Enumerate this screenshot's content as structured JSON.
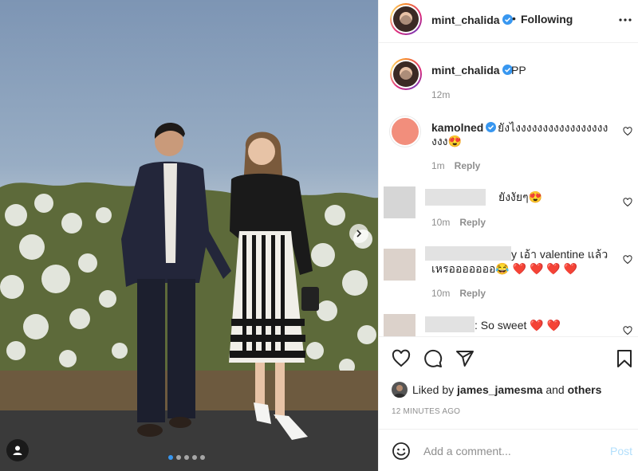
{
  "post": {
    "author": "mint_chalida",
    "follow_status": "Following",
    "separator": "•",
    "carousel_dots": 5,
    "active_dot": 0
  },
  "caption": {
    "author": "mint_chalida",
    "text": "PP",
    "time": "12m"
  },
  "comments": [
    {
      "author": "kamolned",
      "verified": true,
      "text_line1": "ยังไงงงงงงงงงงงงงงงงง",
      "text_line2": "งงง😍",
      "time": "1m",
      "reply": "Reply"
    },
    {
      "author_hidden": true,
      "text": "ยังงัยๆ😍",
      "time": "10m",
      "reply": "Reply"
    },
    {
      "author_hidden": true,
      "text_line1": "y เอ้า valentine แล้ว",
      "text_line2": "เหรอออออออ😂",
      "hearts": "❤️ ❤️ ❤️ ❤️",
      "time": "10m",
      "reply": "Reply"
    },
    {
      "author_hidden": true,
      "text": ": So sweet",
      "hearts": "❤️ ❤️"
    }
  ],
  "likes": {
    "prefix": "Liked by",
    "user": "james_jamesma",
    "and": "and",
    "others": "others",
    "time_ago": "12 minutes ago"
  },
  "composer": {
    "placeholder": "Add a comment...",
    "post_label": "Post"
  },
  "icons": {
    "verified": "verified-badge-icon",
    "more": "more-options-icon",
    "like": "heart-icon",
    "comment": "comment-icon",
    "share": "paper-plane-icon",
    "save": "bookmark-icon",
    "emoji": "emoji-icon",
    "next": "chevron-right-icon",
    "tags": "user-tag-icon"
  },
  "colors": {
    "verified_blue": "#3897f0",
    "heart_red": "#ed1c24",
    "post_disabled": "#b2dffc",
    "muted": "#8e8e8e"
  }
}
